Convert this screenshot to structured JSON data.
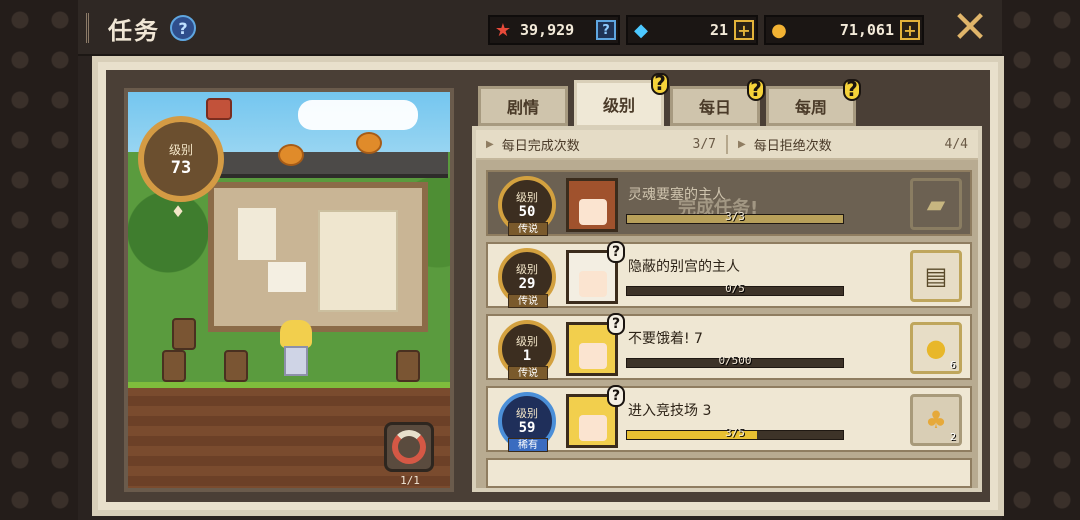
{
  "header": {
    "title": "任务",
    "help_label": "?",
    "resources": {
      "medal": {
        "value": "39,929",
        "icon": "medal-icon",
        "action": "?"
      },
      "gem": {
        "value": "21",
        "icon": "gem-icon",
        "action": "+"
      },
      "gold": {
        "value": "71,061",
        "icon": "coin-icon",
        "action": "+"
      }
    },
    "close_label": "✕"
  },
  "scene": {
    "level_label": "级别",
    "level_value": "73",
    "refresh_count": "1/1"
  },
  "tabs": [
    {
      "label": "剧情",
      "active": false,
      "has_alert": false
    },
    {
      "label": "级别",
      "active": true,
      "has_alert": true
    },
    {
      "label": "每日",
      "active": false,
      "has_alert": true
    },
    {
      "label": "每周",
      "active": false,
      "has_alert": true
    }
  ],
  "stats": {
    "daily_complete_label": "每日完成次数",
    "daily_complete_value": "3/7",
    "daily_reject_label": "每日拒绝次数",
    "daily_reject_value": "4/4"
  },
  "quests": [
    {
      "level_label": "级别",
      "level": "50",
      "rarity": "传说",
      "name": "灵魂要塞的主人",
      "progress_text": "3/3",
      "progress": 1.0,
      "status": "完成任务!",
      "reward_icon": "ticket-icon",
      "reward_count": "",
      "completed": true,
      "color": "#d3a13f"
    },
    {
      "level_label": "级别",
      "level": "29",
      "rarity": "传说",
      "name": "隐蔽的别宫的主人",
      "progress_text": "0/5",
      "progress": 0.0,
      "status": "",
      "reward_icon": "book-icon",
      "reward_count": "",
      "completed": false,
      "color": "#d3a13f"
    },
    {
      "level_label": "级别",
      "level": "1",
      "rarity": "传说",
      "name": "不要饿着! 7",
      "progress_text": "0/500",
      "progress": 0.0,
      "status": "",
      "reward_icon": "gold-pile-icon",
      "reward_count": "6",
      "completed": false,
      "color": "#d3a13f"
    },
    {
      "level_label": "级别",
      "level": "59",
      "rarity": "稀有",
      "name": "进入竞技场 3",
      "progress_text": "3/5",
      "progress": 0.6,
      "status": "",
      "reward_icon": "fruit-icon",
      "reward_count": "2",
      "completed": false,
      "color": "#4b8fd8"
    }
  ]
}
